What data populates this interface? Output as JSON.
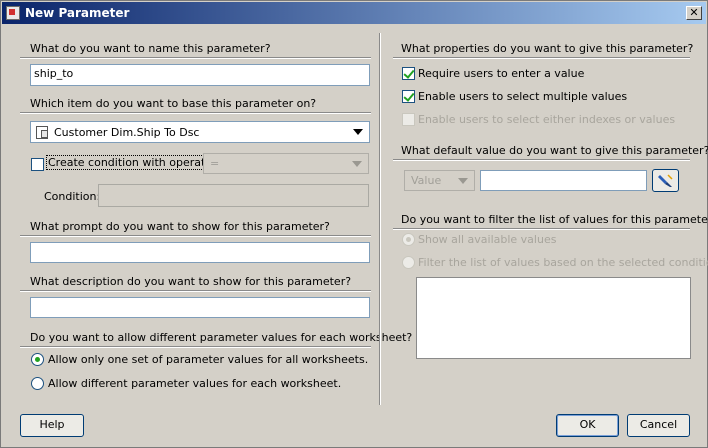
{
  "window": {
    "title": "New Parameter",
    "close_glyph": "✕"
  },
  "left": {
    "q_name": "What do you want to name this parameter?",
    "name_value": "ship_to",
    "q_item": "Which item do you want to base this parameter on?",
    "item_value": "Customer Dim.Ship To Dsc",
    "create_condition_label": "Create condition with operator:",
    "operator_value": "=",
    "condition_label": "Condition:",
    "condition_value": "",
    "q_prompt": "What prompt do you want to show for this parameter?",
    "prompt_value": "",
    "q_description": "What description do you want to show for this parameter?",
    "description_value": "",
    "q_worksheet": "Do you want to allow different parameter values for each worksheet?",
    "radio_one_set": "Allow only one set of parameter values for all worksheets.",
    "radio_different": "Allow different parameter values for each worksheet."
  },
  "right": {
    "q_properties": "What properties do you want to give this parameter?",
    "require_label": "Require users to enter a value",
    "multiple_label": "Enable users to select multiple values",
    "indexes_label": "Enable users to select either indexes or values",
    "q_default": "What default value do you want to give this parameter?",
    "default_type": "Value",
    "default_value": "",
    "q_filter": "Do you want to filter the list of values for this parameter?",
    "radio_show_all": "Show all available values",
    "radio_filter": "Filter the list of values based on the selected conditions:"
  },
  "buttons": {
    "help": "Help",
    "ok": "OK",
    "cancel": "Cancel"
  }
}
